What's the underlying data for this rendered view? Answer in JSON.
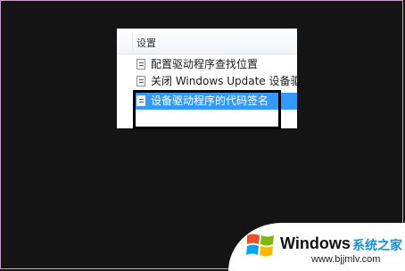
{
  "panel": {
    "header": "设置",
    "items": [
      {
        "label": "配置驱动程序查找位置",
        "selected": false
      },
      {
        "label": "关闭 Windows Update 设备驱动程序搜索提示",
        "selected": false
      },
      {
        "label": "设备驱动程序的代码签名",
        "selected": true
      }
    ]
  },
  "watermark": {
    "brand": "Windows",
    "site_name": "系统之家",
    "url": "www.bjjmlv.com"
  },
  "colors": {
    "background": "#141414",
    "selection": "#3399ff",
    "highlight_box": "#000000",
    "watermark_accent": "#1a8fd8"
  }
}
